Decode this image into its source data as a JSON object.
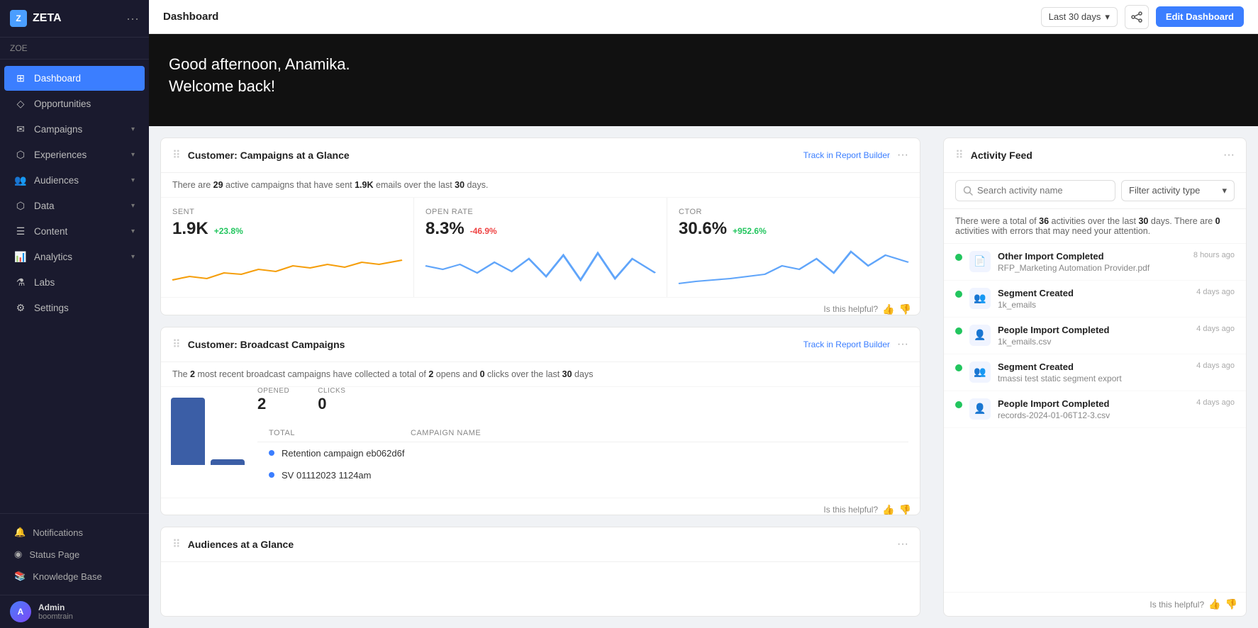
{
  "app": {
    "name": "ZETA",
    "logo_initial": "Z"
  },
  "sidebar": {
    "org": "ZOE",
    "nav_items": [
      {
        "id": "dashboard",
        "label": "Dashboard",
        "icon": "⊞",
        "active": true,
        "has_chevron": false
      },
      {
        "id": "opportunities",
        "label": "Opportunities",
        "icon": "◇",
        "active": false,
        "has_chevron": false
      },
      {
        "id": "campaigns",
        "label": "Campaigns",
        "icon": "✉",
        "active": false,
        "has_chevron": true
      },
      {
        "id": "experiences",
        "label": "Experiences",
        "icon": "⬡",
        "active": false,
        "has_chevron": true
      },
      {
        "id": "audiences",
        "label": "Audiences",
        "icon": "👥",
        "active": false,
        "has_chevron": true
      },
      {
        "id": "data",
        "label": "Data",
        "icon": "⬡",
        "active": false,
        "has_chevron": true
      },
      {
        "id": "content",
        "label": "Content",
        "icon": "☰",
        "active": false,
        "has_chevron": true
      },
      {
        "id": "analytics",
        "label": "Analytics",
        "icon": "📊",
        "active": false,
        "has_chevron": true
      },
      {
        "id": "labs",
        "label": "Labs",
        "icon": "⚗",
        "active": false,
        "has_chevron": false
      },
      {
        "id": "settings",
        "label": "Settings",
        "icon": "⚙",
        "active": false,
        "has_chevron": false
      }
    ],
    "bottom_items": [
      {
        "id": "notifications",
        "label": "Notifications",
        "icon": "🔔"
      },
      {
        "id": "status",
        "label": "Status Page",
        "icon": "◉"
      },
      {
        "id": "knowledge",
        "label": "Knowledge Base",
        "icon": "📚"
      }
    ],
    "user": {
      "name": "Admin",
      "sub": "boomtrain",
      "initials": "A"
    }
  },
  "topbar": {
    "title": "Dashboard",
    "date_range": "Last 30 days",
    "edit_label": "Edit Dashboard"
  },
  "hero": {
    "greeting_line1": "Good afternoon, Anamika.",
    "greeting_line2": "Welcome back!"
  },
  "campaigns_card": {
    "title": "Customer: Campaigns at a Glance",
    "track_link": "Track in Report Builder",
    "summary_pre": "There are ",
    "summary_count": "29",
    "summary_mid": " active campaigns that have sent ",
    "summary_emails": "1.9K",
    "summary_post": " emails over the last ",
    "summary_days": "30",
    "summary_end": " days.",
    "metrics": [
      {
        "label": "Sent",
        "value": "1.9K",
        "change": "+23.8%",
        "positive": true
      },
      {
        "label": "Open Rate",
        "value": "8.3%",
        "change": "-46.9%",
        "positive": false
      },
      {
        "label": "CTOR",
        "value": "30.6%",
        "change": "+952.6%",
        "positive": true
      }
    ],
    "helpful_text": "Is this helpful?",
    "thumbs_up": "👍",
    "thumbs_down": "👎"
  },
  "broadcast_card": {
    "title": "Customer: Broadcast Campaigns",
    "track_link": "Track in Report Builder",
    "summary_pre": "The ",
    "summary_count": "2",
    "summary_mid": " most recent broadcast campaigns have collected a total of ",
    "summary_opens": "2",
    "summary_mid2": " opens and ",
    "summary_clicks": "0",
    "summary_post": " clicks over the last ",
    "summary_days": "30",
    "summary_end": " days",
    "col_total": "TOTAL",
    "col_campaign": "CAMPAIGN NAME",
    "opened_label": "Opened",
    "opened_value": "2",
    "clicks_label": "Clicks",
    "clicks_value": "0",
    "campaigns": [
      {
        "name": "Retention campaign eb062d6f"
      },
      {
        "name": "SV 01112023 1124am"
      }
    ],
    "helpful_text": "Is this helpful?",
    "bar_height_opened": 90,
    "bar_height_clicks": 10
  },
  "audiences_card": {
    "title": "Audiences at a Glance",
    "more_icon": "⋯"
  },
  "activity_feed": {
    "title": "Activity Feed",
    "search_placeholder": "Search activity name",
    "filter_placeholder": "Filter activity type",
    "summary_pre": "There were a total of ",
    "summary_count": "36",
    "summary_mid": " activities over the last ",
    "summary_days": "30",
    "summary_post": " days. There are ",
    "summary_errors": "0",
    "summary_end": " activities with errors that may need your attention.",
    "items": [
      {
        "type": "import",
        "icon": "📄",
        "name": "Other Import Completed",
        "sub": "RFP_Marketing Automation Provider.pdf",
        "time": "8 hours ago"
      },
      {
        "type": "segment",
        "icon": "👥",
        "name": "Segment Created",
        "sub": "1k_emails",
        "time": "4 days ago"
      },
      {
        "type": "import",
        "icon": "👤",
        "name": "People Import Completed",
        "sub": "1k_emails.csv",
        "time": "4 days ago"
      },
      {
        "type": "segment",
        "icon": "👥",
        "name": "Segment Created",
        "sub": "tmassi test static segment export",
        "time": "4 days ago"
      },
      {
        "type": "import",
        "icon": "👤",
        "name": "People Import Completed",
        "sub": "records-2024-01-06T12-3.csv",
        "time": "4 days ago"
      }
    ],
    "helpful_text": "Is this helpful?"
  }
}
